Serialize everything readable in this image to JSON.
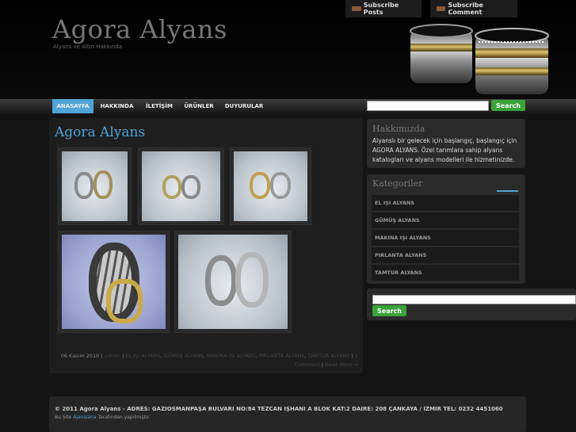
{
  "header": {
    "site_title": "Agora Alyans",
    "site_description": "Alyans ve Altın Hakkında",
    "subscribe_posts": "Subscribe Posts",
    "subscribe_comment": "Subscribe Comment",
    "rss_icon": "rss-feed-icon"
  },
  "nav": {
    "items": [
      "ANASAYFA",
      "HAKKINDA",
      "İLETİŞİM",
      "ÜRÜNLER",
      "DUYURULAR"
    ],
    "active_index": 0,
    "search_button": "Search",
    "search_value": ""
  },
  "post": {
    "title": "Agora Alyans",
    "image_count": 5,
    "date": "06 Kasım 2010",
    "author": "admin",
    "categories": [
      "EL IŞI ALYANS",
      "GÜMÜŞ ALYANS",
      "MAKINA IŞI ALYANS",
      "PIRLANTA ALYANS",
      "TAMTUR ALYANS"
    ],
    "comments": "1 Comment",
    "read_more": "Read More →"
  },
  "sidebar": {
    "about_title": "Hakkımızda",
    "about_text": "Alyanslı bir gelecek için başlangıç, başlangıç için AGORA ALYANS. Özel tarımlara sahip alyans katalogları ve alyans modelleri ile hizmetinizde.",
    "categories_title": "Kategoriler",
    "categories": [
      "EL IŞI ALYANS",
      "GÜMÜŞ ALYANS",
      "MAKINA IŞI ALYANS",
      "PIRLANTA ALYANS",
      "TAMTUR ALYANS"
    ],
    "search_button": "Search",
    "search_value": ""
  },
  "footer": {
    "line1": "© 2011 Agora Alyans - ADRES: GAZIOSMANPAŞA BULVARI NO:84 TEZCAN IŞHANI A BLOK KAT:2 DAIRE: 208 ÇANKAYA / IZMIR TEL: 0232 4451060",
    "line2_prefix": "Bu Site",
    "line2_link": "Ajansiana",
    "line2_suffix": "Tarafından yapılmıştır."
  },
  "colors": {
    "accent": "#4fa3d6",
    "button_green": "#3aa33a",
    "background": "#141414"
  }
}
